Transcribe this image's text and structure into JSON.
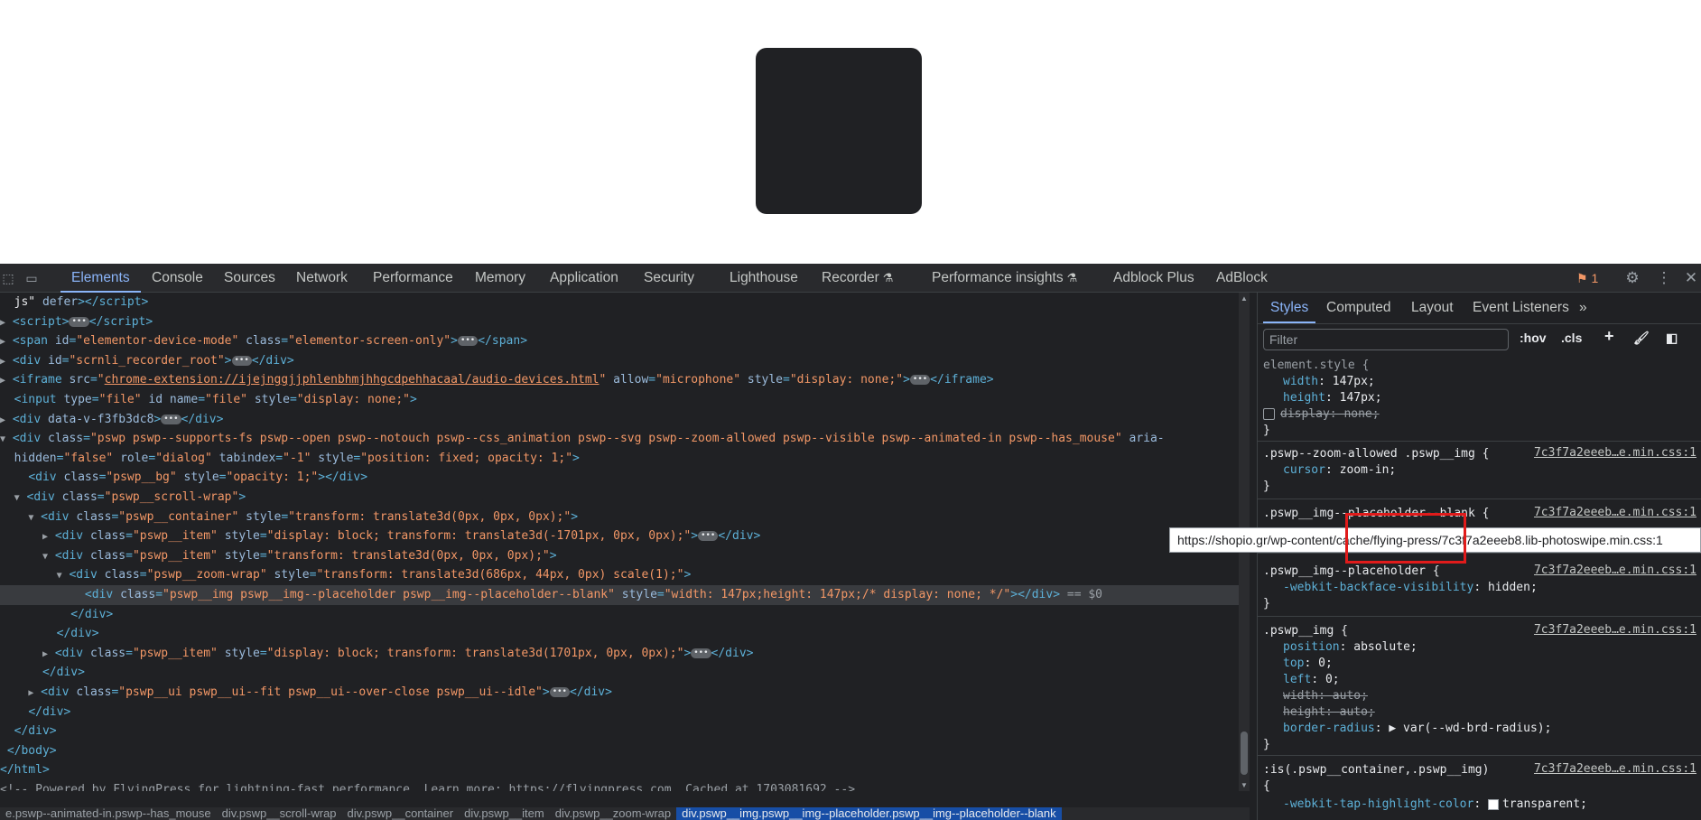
{
  "devtools": {
    "tabs": [
      "Elements",
      "Console",
      "Sources",
      "Network",
      "Performance",
      "Memory",
      "Application",
      "Security",
      "Lighthouse",
      "Recorder",
      "Performance insights",
      "Adblock Plus",
      "AdBlock"
    ],
    "issues_count": "1"
  },
  "elements": {
    "lines": [
      {
        "h": "  <span class='tx'>js\" </span><span class='a'>defer</span><span class='t'>&gt;&lt;/script&gt;</span>"
      },
      {
        "h": "<span class='tri'>▶</span> <span class='t'>&lt;script&gt;</span><span class='dots'>•••</span><span class='t'>&lt;/script&gt;</span>"
      },
      {
        "h": "<span class='tri'>▶</span> <span class='t'>&lt;span </span><span class='a'>id</span><span class='t'>=</span><span class='v'>\"elementor-device-mode\"</span> <span class='a'>class</span><span class='t'>=</span><span class='v'>\"elementor-screen-only\"</span><span class='t'>&gt;</span><span class='dots'>•••</span><span class='t'>&lt;/span&gt;</span>"
      },
      {
        "h": "<span class='tri'>▶</span> <span class='t'>&lt;div </span><span class='a'>id</span><span class='t'>=</span><span class='v'>\"scrnli_recorder_root\"</span><span class='t'>&gt;</span><span class='dots'>•••</span><span class='t'>&lt;/div&gt;</span>"
      },
      {
        "h": "<span class='tri'>▶</span> <span class='t'>&lt;iframe </span><span class='a'>src</span><span class='t'>=</span><span class='v'>\"</span><span class='lnk'>chrome-extension://ijejnggjjphlenbhmjhhgcdpehhacaal/audio-devices.html</span><span class='v'>\"</span> <span class='a'>allow</span><span class='t'>=</span><span class='v'>\"microphone\"</span> <span class='a'>style</span><span class='t'>=</span><span class='v'>\"display: none;\"</span><span class='t'>&gt;</span><span class='dots'>•••</span><span class='t'>&lt;/iframe&gt;</span>"
      },
      {
        "h": "  <span class='t'>&lt;input </span><span class='a'>type</span><span class='t'>=</span><span class='v'>\"file\"</span> <span class='a'>id name</span><span class='t'>=</span><span class='v'>\"file\"</span> <span class='a'>style</span><span class='t'>=</span><span class='v'>\"display: none;\"</span><span class='t'>&gt;</span>"
      },
      {
        "h": "<span class='tri'>▶</span> <span class='t'>&lt;div </span><span class='a'>data-v-f3fb3dc8</span><span class='t'>&gt;</span><span class='dots'>•••</span><span class='t'>&lt;/div&gt;</span>"
      },
      {
        "h": "<span class='tri'>▼</span> <span class='t'>&lt;div </span><span class='a'>class</span><span class='t'>=</span><span class='v'>\"pswp pswp--supports-fs pswp--open pswp--notouch pswp--css_animation pswp--svg pswp--zoom-allowed pswp--visible pswp--animated-in pswp--has_mouse\"</span> <span class='a'>aria-</span>"
      },
      {
        "h": "  <span class='a'>hidden</span><span class='t'>=</span><span class='v'>\"false\"</span> <span class='a'>role</span><span class='t'>=</span><span class='v'>\"dialog\"</span> <span class='a'>tabindex</span><span class='t'>=</span><span class='v'>\"-1\"</span> <span class='a'>style</span><span class='t'>=</span><span class='v'>\"position: fixed; opacity: 1;\"</span><span class='t'>&gt;</span>"
      },
      {
        "h": "    <span class='t'>&lt;div </span><span class='a'>class</span><span class='t'>=</span><span class='v'>\"pswp__bg\"</span> <span class='a'>style</span><span class='t'>=</span><span class='v'>\"opacity: 1;\"</span><span class='t'>&gt;&lt;/div&gt;</span>"
      },
      {
        "h": "  <span class='tri'>▼</span> <span class='t'>&lt;div </span><span class='a'>class</span><span class='t'>=</span><span class='v'>\"pswp__scroll-wrap\"</span><span class='t'>&gt;</span>"
      },
      {
        "h": "    <span class='tri'>▼</span> <span class='t'>&lt;div </span><span class='a'>class</span><span class='t'>=</span><span class='v'>\"pswp__container\"</span> <span class='a'>style</span><span class='t'>=</span><span class='v'>\"transform: translate3d(0px, 0px, 0px);\"</span><span class='t'>&gt;</span>"
      },
      {
        "h": "      <span class='tri'>▶</span> <span class='t'>&lt;div </span><span class='a'>class</span><span class='t'>=</span><span class='v'>\"pswp__item\"</span> <span class='a'>style</span><span class='t'>=</span><span class='v'>\"display: block; transform: translate3d(-1701px, 0px, 0px);\"</span><span class='t'>&gt;</span><span class='dots'>•••</span><span class='t'>&lt;/div&gt;</span>"
      },
      {
        "h": "      <span class='tri'>▼</span> <span class='t'>&lt;div </span><span class='a'>class</span><span class='t'>=</span><span class='v'>\"pswp__item\"</span> <span class='a'>style</span><span class='t'>=</span><span class='v'>\"transform: translate3d(0px, 0px, 0px);\"</span><span class='t'>&gt;</span>"
      },
      {
        "h": "        <span class='tri'>▼</span> <span class='t'>&lt;div </span><span class='a'>class</span><span class='t'>=</span><span class='v'>\"pswp__zoom-wrap\"</span> <span class='a'>style</span><span class='t'>=</span><span class='v'>\"transform: translate3d(686px, 44px, 0px) scale(1);\"</span><span class='t'>&gt;</span>"
      },
      {
        "h": "            <span class='t'>&lt;div </span><span class='a'>class</span><span class='t'>=</span><span class='v'>\"pswp__img pswp__img--placeholder pswp__img--placeholder--blank\"</span> <span class='a'>style</span><span class='t'>=</span><span class='v'>\"width: 147px;height: 147px;/* display: none; */\"</span><span class='t'>&gt;&lt;/div&gt;</span> <span class='cm'>== $0</span>",
        "sel": true
      },
      {
        "h": "          <span class='t'>&lt;/div&gt;</span>"
      },
      {
        "h": "        <span class='t'>&lt;/div&gt;</span>"
      },
      {
        "h": "      <span class='tri'>▶</span> <span class='t'>&lt;div </span><span class='a'>class</span><span class='t'>=</span><span class='v'>\"pswp__item\"</span> <span class='a'>style</span><span class='t'>=</span><span class='v'>\"display: block; transform: translate3d(1701px, 0px, 0px);\"</span><span class='t'>&gt;</span><span class='dots'>•••</span><span class='t'>&lt;/div&gt;</span>"
      },
      {
        "h": "      <span class='t'>&lt;/div&gt;</span>"
      },
      {
        "h": "    <span class='tri'>▶</span> <span class='t'>&lt;div </span><span class='a'>class</span><span class='t'>=</span><span class='v'>\"pswp__ui pswp__ui--fit pswp__ui--over-close pswp__ui--idle\"</span><span class='t'>&gt;</span><span class='dots'>•••</span><span class='t'>&lt;/div&gt;</span>"
      },
      {
        "h": "    <span class='t'>&lt;/div&gt;</span>"
      },
      {
        "h": "  <span class='t'>&lt;/div&gt;</span>"
      },
      {
        "h": " <span class='t'>&lt;/body&gt;</span>"
      },
      {
        "h": "<span class='t'>&lt;/html&gt;</span>"
      },
      {
        "h": "<span class='cm'>&lt;!-- Powered by FlyingPress for lightning-fast performance. Learn more: https://flyingpress.com. Cached at 1703081692 --&gt;</span>"
      }
    ]
  },
  "breadcrumbs": [
    "e.pswp--animated-in.pswp--has_mouse",
    "div.pswp__scroll-wrap",
    "div.pswp__container",
    "div.pswp__item",
    "div.pswp__zoom-wrap",
    "div.pswp__img.pswp__img--placeholder.pswp__img--placeholder--blank"
  ],
  "styles": {
    "tabs": [
      "Styles",
      "Computed",
      "Layout",
      "Event Listeners"
    ],
    "filter_placeholder": "Filter",
    "hov": ":hov",
    "cls": ".cls",
    "source": "7c3f7a2eeeb…e.min.css:1",
    "element_style_selector": "element.style {",
    "es_width": "147px;",
    "es_height": "147px;",
    "es_display": "none;",
    "rule1_selector": ".pswp--zoom-allowed .pswp__img {",
    "rule1_prop": "cursor",
    "rule1_val": "zoom-in;",
    "rule2_selector": ".pswp__img--placeholder--blank {",
    "rule3_selector": ".pswp__img--placeholder {",
    "rule3_prop": "-webkit-backface-visibility",
    "rule3_val": "hidden;",
    "rule4_selector": ".pswp__img {",
    "rule4_props": [
      {
        "p": "position",
        "v": "absolute;"
      },
      {
        "p": "top",
        "v": "0;"
      },
      {
        "p": "left",
        "v": "0;"
      },
      {
        "p": "width",
        "v": "auto;",
        "s": true
      },
      {
        "p": "height",
        "v": "auto;",
        "s": true
      },
      {
        "p": "border-radius",
        "v": "▶ var(--wd-brd-radius);"
      }
    ],
    "rule5_selector": ":is(.pswp__container,.pswp__img)",
    "rule5_prop": "-webkit-tap-highlight-color",
    "rule5_val": "transparent;",
    "close_brace": "}",
    "open_brace": "{"
  },
  "tooltip": "https://shopio.gr/wp-content/cache/flying-press/7c3f7a2eeeb8.lib-photoswipe.min.css:1"
}
